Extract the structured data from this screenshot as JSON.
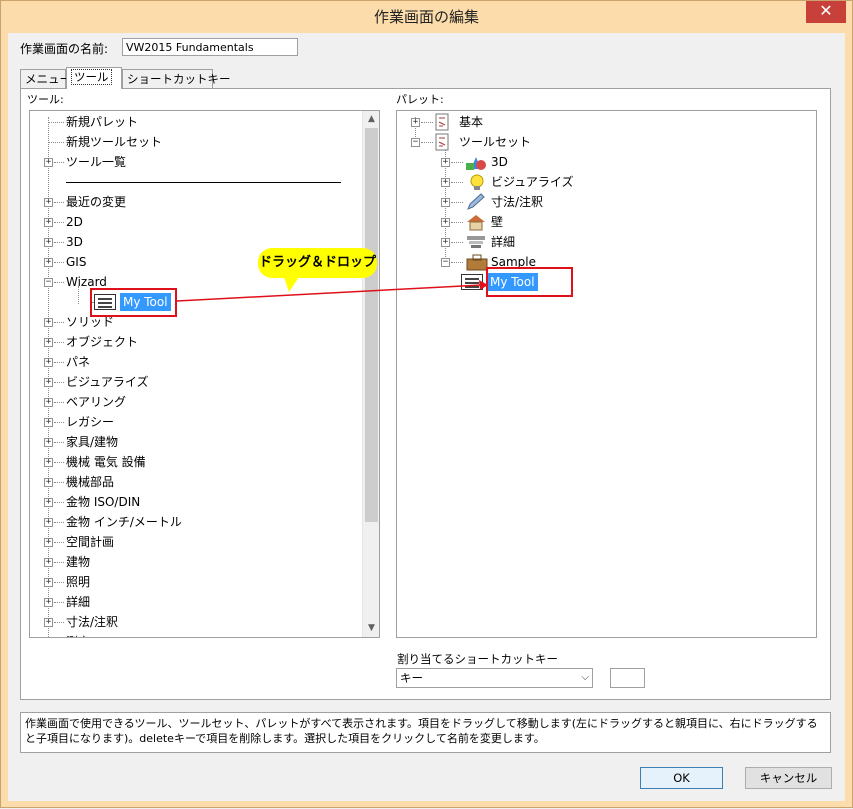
{
  "window": {
    "title": "作業画面の編集",
    "close_glyph": "✕"
  },
  "workspace_name": {
    "label": "作業画面の名前:",
    "value": "VW2015 Fundamentals"
  },
  "tabs": [
    {
      "label": "メニュー",
      "active": false
    },
    {
      "label": "ツール",
      "active": true
    },
    {
      "label": "ショートカットキー",
      "active": false
    }
  ],
  "tools_panel": {
    "label": "ツール:",
    "items": [
      {
        "label": "新規パレット",
        "expander": "",
        "indent": 0
      },
      {
        "label": "新規ツールセット",
        "expander": "",
        "indent": 0
      },
      {
        "label": "ツール一覧",
        "expander": "+",
        "indent": 0
      },
      {
        "label": "",
        "expander": "",
        "indent": 0,
        "separator": true
      },
      {
        "label": "最近の変更",
        "expander": "+",
        "indent": 0
      },
      {
        "label": "2D",
        "expander": "+",
        "indent": 0
      },
      {
        "label": "3D",
        "expander": "+",
        "indent": 0
      },
      {
        "label": "GIS",
        "expander": "+",
        "indent": 0
      },
      {
        "label": "Wizard",
        "expander": "−",
        "indent": 0
      },
      {
        "label": "My Tool",
        "expander": "",
        "indent": 1,
        "selected": true
      },
      {
        "label": "ソリッド",
        "expander": "+",
        "indent": 0
      },
      {
        "label": "オブジェクト",
        "expander": "+",
        "indent": 0
      },
      {
        "label": "パネ",
        "expander": "+",
        "indent": 0
      },
      {
        "label": "ビジュアライズ",
        "expander": "+",
        "indent": 0
      },
      {
        "label": "ベアリング",
        "expander": "+",
        "indent": 0
      },
      {
        "label": "レガシー",
        "expander": "+",
        "indent": 0
      },
      {
        "label": "家具/建物",
        "expander": "+",
        "indent": 0
      },
      {
        "label": "機械 電気 設備",
        "expander": "+",
        "indent": 0
      },
      {
        "label": "機械部品",
        "expander": "+",
        "indent": 0
      },
      {
        "label": "金物 ISO/DIN",
        "expander": "+",
        "indent": 0
      },
      {
        "label": "金物 インチ/メートル",
        "expander": "+",
        "indent": 0
      },
      {
        "label": "空間計画",
        "expander": "+",
        "indent": 0
      },
      {
        "label": "建物",
        "expander": "+",
        "indent": 0
      },
      {
        "label": "照明",
        "expander": "+",
        "indent": 0
      },
      {
        "label": "詳細",
        "expander": "+",
        "indent": 0
      },
      {
        "label": "寸法/注釈",
        "expander": "+",
        "indent": 0
      },
      {
        "label": "測定",
        "expander": "+",
        "indent": 0
      }
    ]
  },
  "palettes_panel": {
    "label": "パレット:",
    "items": [
      {
        "label": "基本",
        "expander": "+",
        "indent": 0,
        "icon": "palette-icon"
      },
      {
        "label": "ツールセット",
        "expander": "−",
        "indent": 0,
        "icon": "palette-icon"
      },
      {
        "label": "3D",
        "expander": "+",
        "indent": 1,
        "icon": "3d-shapes-icon"
      },
      {
        "label": "ビジュアライズ",
        "expander": "+",
        "indent": 1,
        "icon": "lightbulb-icon"
      },
      {
        "label": "寸法/注釈",
        "expander": "+",
        "indent": 1,
        "icon": "pencil-icon"
      },
      {
        "label": "壁",
        "expander": "+",
        "indent": 1,
        "icon": "house-icon"
      },
      {
        "label": "詳細",
        "expander": "+",
        "indent": 1,
        "icon": "detail-icon"
      },
      {
        "label": "Sample",
        "expander": "−",
        "indent": 1,
        "icon": "toolbox-icon"
      },
      {
        "label": "My Tool",
        "expander": "",
        "indent": 2,
        "icon": "tool-icon",
        "selected": true
      }
    ]
  },
  "shortcut": {
    "label": "割り当てるショートカットキー",
    "select_value": "キー"
  },
  "annotation": {
    "callout": "ドラッグ＆ドロップ"
  },
  "help_text": "作業画面で使用できるツール、ツールセット、パレットがすべて表示されます。項目をドラッグして移動します(左にドラッグすると親項目に、右にドラッグすると子項目になります)。deleteキーで項目を削除します。選択した項目をクリックして名前を変更します。",
  "buttons": {
    "ok": "OK",
    "cancel": "キャンセル"
  },
  "colors": {
    "selection": "#3399ff",
    "annotation_red": "#e0101a",
    "callout_yellow": "#ffff00",
    "frame": "#fcdcab"
  }
}
